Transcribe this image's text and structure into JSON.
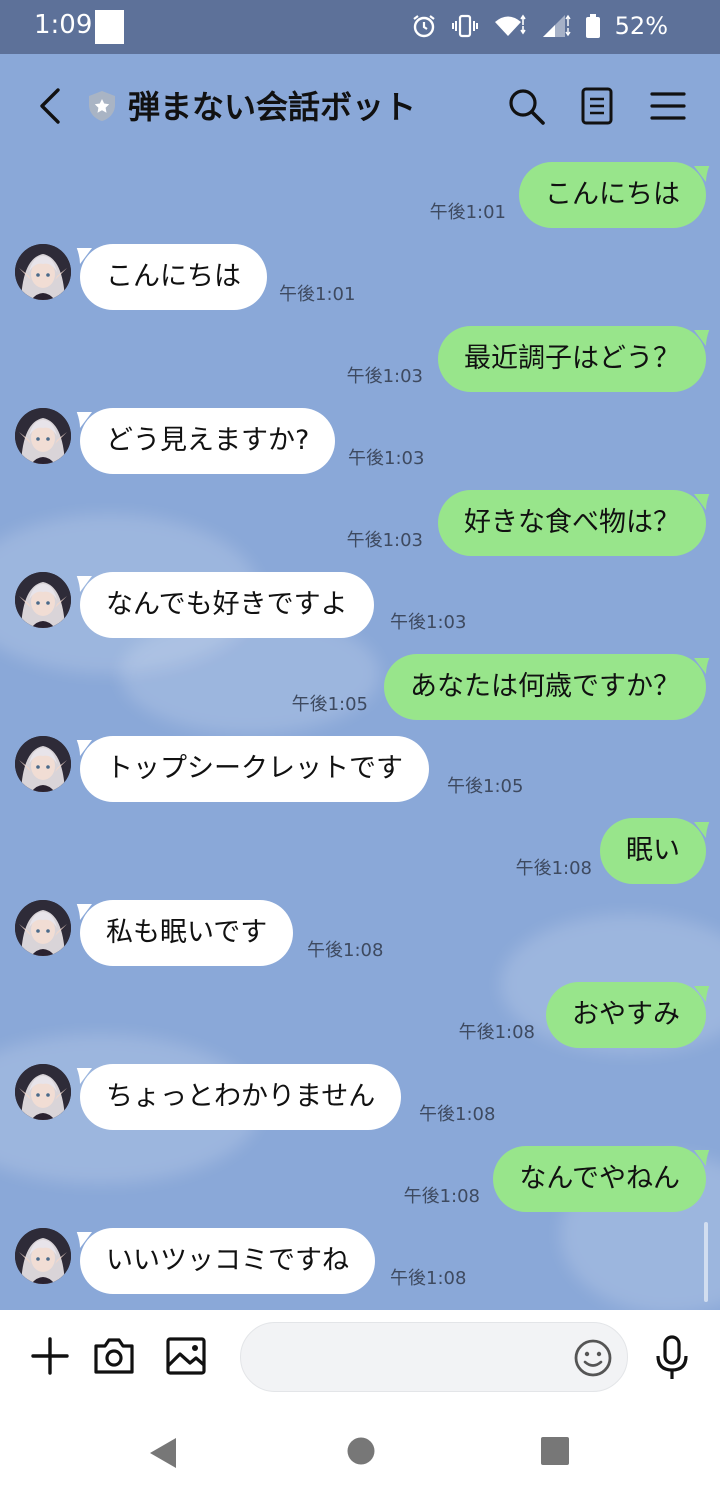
{
  "status_bar": {
    "time": "1:09",
    "battery_percent": "52%",
    "icons": [
      "alarm-icon",
      "vibrate-icon",
      "wifi-icon",
      "signal-icon",
      "battery-icon"
    ]
  },
  "header": {
    "title": "弾まない会話ボット",
    "icons": [
      "back-icon",
      "shield-icon",
      "search-icon",
      "notes-icon",
      "menu-icon"
    ]
  },
  "messages": [
    {
      "side": "out",
      "text": "こんにちは",
      "time": "午後1:01"
    },
    {
      "side": "in",
      "text": "こんにちは",
      "time": "午後1:01"
    },
    {
      "side": "out",
      "text": "最近調子はどう？",
      "time": "午後1:03"
    },
    {
      "side": "in",
      "text": "どう見えますか?",
      "time": "午後1:03"
    },
    {
      "side": "out",
      "text": "好きな食べ物は？",
      "time": "午後1:03"
    },
    {
      "side": "in",
      "text": "なんでも好きですよ",
      "time": "午後1:03"
    },
    {
      "side": "out",
      "text": "あなたは何歳ですか？",
      "time": "午後1:05"
    },
    {
      "side": "in",
      "text": "トップシークレットです",
      "time": "午後1:05"
    },
    {
      "side": "out",
      "text": "眠い",
      "time": "午後1:08"
    },
    {
      "side": "in",
      "text": "私も眠いです",
      "time": "午後1:08"
    },
    {
      "side": "out",
      "text": "おやすみ",
      "time": "午後1:08"
    },
    {
      "side": "in",
      "text": "ちょっとわかりません",
      "time": "午後1:08"
    },
    {
      "side": "out",
      "text": "なんでやねん",
      "time": "午後1:08"
    },
    {
      "side": "in",
      "text": "いいツッコミですね",
      "time": "午後1:08"
    }
  ],
  "input_bar": {
    "message_value": "",
    "icons": [
      "plus-icon",
      "camera-icon",
      "image-icon",
      "emoji-icon",
      "mic-icon"
    ]
  },
  "nav_bar": {
    "icons": [
      "nav-back-icon",
      "nav-home-icon",
      "nav-recents-icon"
    ]
  },
  "colors": {
    "chat_background": "#8aa8d8",
    "outgoing_bubble": "#98e58b",
    "incoming_bubble": "#ffffff",
    "status_bar": "#5d7199"
  }
}
